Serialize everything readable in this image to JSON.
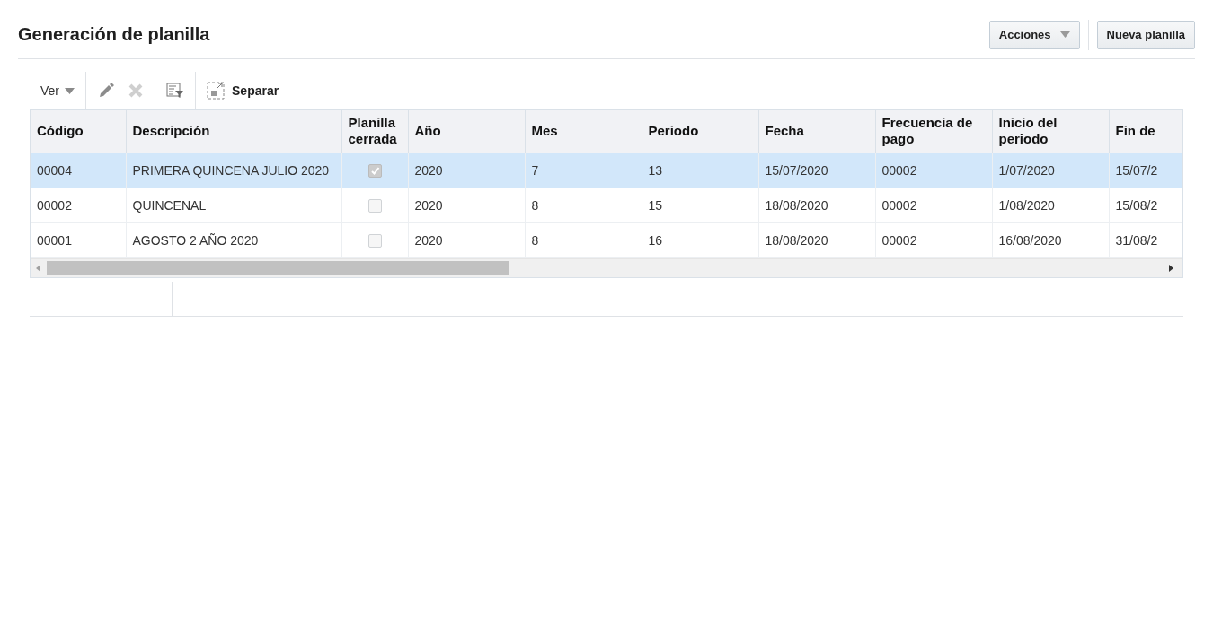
{
  "page": {
    "title": "Generación de planilla"
  },
  "header_buttons": [
    {
      "kind": "menu",
      "label": "Acciones"
    },
    {
      "kind": "plain",
      "label": "Nueva planilla"
    }
  ],
  "toolbar": {
    "view_menu": "Ver",
    "edit_disabled": true,
    "delete_disabled": true,
    "detach": "Separar"
  },
  "table": {
    "columns": [
      "Código",
      "Descripción",
      "Planilla cerrada",
      "Año",
      "Mes",
      "Periodo",
      "Fecha",
      "Frecuencia de pago",
      "Inicio del periodo",
      "Fin de"
    ],
    "rows": [
      {
        "selected": true,
        "closed": true,
        "cells": [
          "00004",
          "PRIMERA QUINCENA JULIO 2020",
          "",
          "2020",
          "7",
          "13",
          "15/07/2020",
          "00002",
          "1/07/2020",
          "15/07/2"
        ]
      },
      {
        "selected": false,
        "closed": false,
        "cells": [
          "00002",
          "QUINCENAL",
          "",
          "2020",
          "8",
          "15",
          "18/08/2020",
          "00002",
          "1/08/2020",
          "15/08/2"
        ]
      },
      {
        "selected": false,
        "closed": false,
        "cells": [
          "00001",
          "AGOSTO 2 AÑO 2020",
          "",
          "2020",
          "8",
          "16",
          "18/08/2020",
          "00002",
          "16/08/2020",
          "31/08/2"
        ]
      }
    ]
  }
}
